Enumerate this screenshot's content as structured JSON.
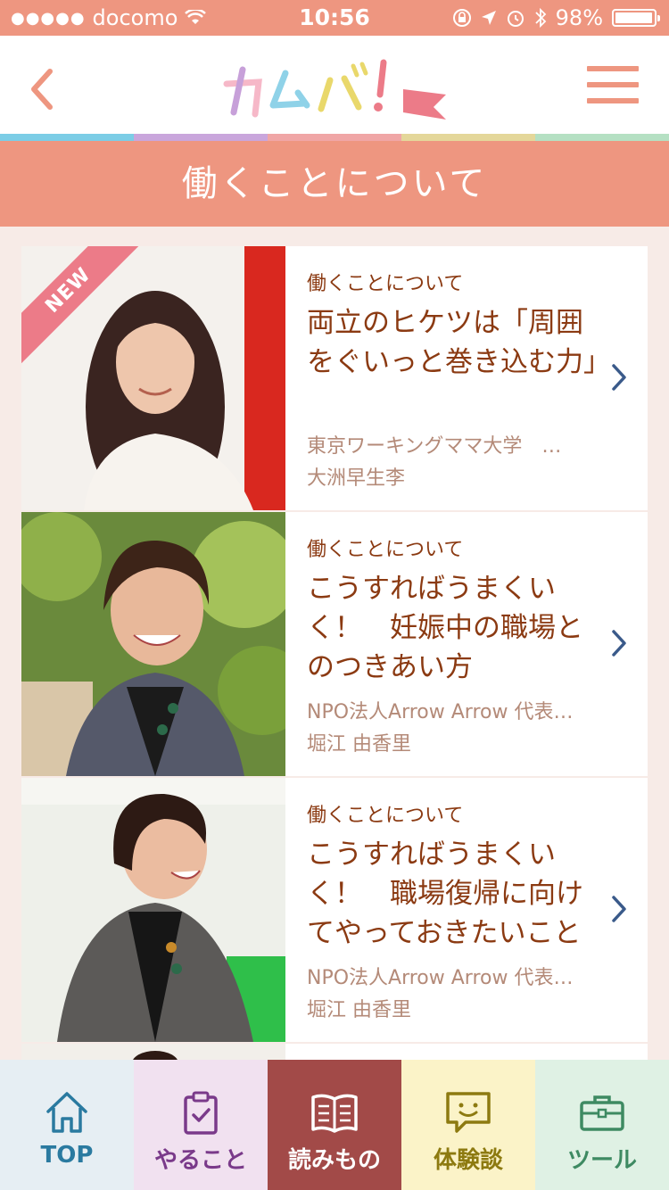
{
  "status_bar": {
    "carrier": "docomo",
    "time": "10:56",
    "battery": "98%"
  },
  "header": {
    "logo_text": "カムバ!",
    "stripe_colors": [
      "#7ccde6",
      "#c9a6dc",
      "#f0a6a6",
      "#e4d79a",
      "#b5e0c3"
    ]
  },
  "page_title": "働くことについて",
  "articles": [
    {
      "is_new": true,
      "new_label": "NEW",
      "category": "働くことについて",
      "title": "両立のヒケツは「周囲をぐいっと巻き込む力」",
      "org": "東京ワーキングママ大学　…",
      "author": "大洲早生李"
    },
    {
      "is_new": false,
      "category": "働くことについて",
      "title": "こうすればうまくいく！　妊娠中の職場とのつきあい方",
      "org": "NPO法人Arrow Arrow 代表…",
      "author": "堀江 由香里"
    },
    {
      "is_new": false,
      "category": "働くことについて",
      "title": "こうすればうまくいく！　職場復帰に向けてやっておきたいこと",
      "org": "NPO法人Arrow Arrow 代表…",
      "author": "堀江 由香里"
    }
  ],
  "tabs": [
    {
      "label": "TOP",
      "icon": "home-icon"
    },
    {
      "label": "やること",
      "icon": "clipboard-icon"
    },
    {
      "label": "読みもの",
      "icon": "book-icon",
      "active": true
    },
    {
      "label": "体験談",
      "icon": "chat-bubble-icon"
    },
    {
      "label": "ツール",
      "icon": "toolbox-icon"
    }
  ],
  "colors": {
    "accent": "#ee9680",
    "text_brown": "#8b3a12",
    "chevron": "#3a5a8a"
  }
}
